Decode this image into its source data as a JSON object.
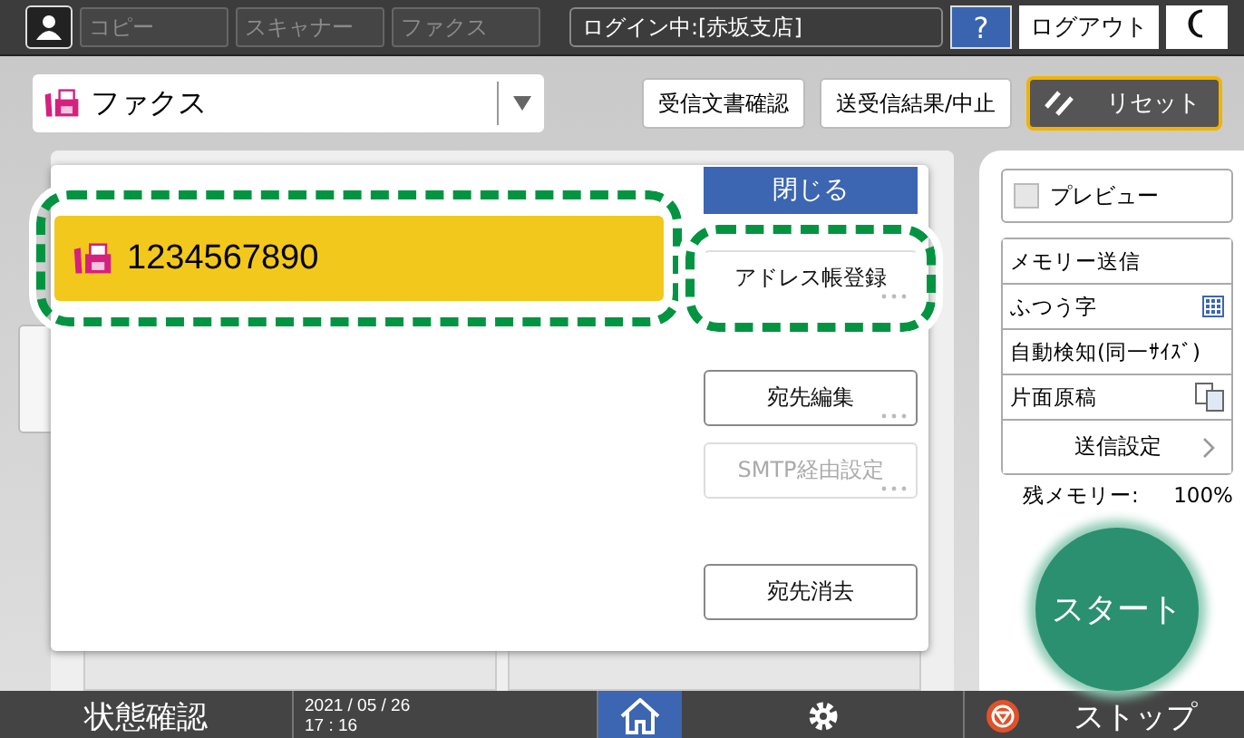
{
  "top_bar": {
    "tabs": [
      {
        "label": "コピー",
        "disabled": true
      },
      {
        "label": "スキャナー",
        "disabled": true
      },
      {
        "label": "ファクス",
        "disabled": true
      }
    ],
    "login": "ログイン中:[赤坂支店]",
    "help": "?",
    "logout": "ログアウト"
  },
  "app_selector": {
    "label": "ファクス"
  },
  "header_buttons": [
    "受信文書確認",
    "送受信結果/中止"
  ],
  "reset": {
    "label": "リセット"
  },
  "popup": {
    "destination": {
      "number": "1234567890",
      "selected": true,
      "highlighted": true
    },
    "close": "閉じる",
    "actions": [
      {
        "label": "アドレス帳登録",
        "disabled": false,
        "more": true,
        "highlighted": true
      },
      {
        "label": "宛先編集",
        "disabled": false,
        "more": true,
        "highlighted": false
      },
      {
        "label": "SMTP経由設定",
        "disabled": true,
        "more": true,
        "highlighted": false
      },
      {
        "label": "宛先消去",
        "disabled": false,
        "more": false,
        "highlighted": false
      }
    ]
  },
  "settings": {
    "preview": {
      "label": "プレビュー",
      "checked": false
    },
    "items": [
      {
        "label": "メモリー送信",
        "kind": "plain"
      },
      {
        "label": "ふつう字",
        "kind": "resolution"
      },
      {
        "label": "自動検知(同一ｻｲｽﾞ)",
        "kind": "plain"
      },
      {
        "label": "片面原稿",
        "kind": "sides"
      }
    ],
    "send_settings": "送信設定",
    "memory_label": "残メモリー:",
    "memory_value": "100%"
  },
  "start": "スタート",
  "bottom_bar": {
    "status": "状態確認",
    "date": "2021 / 05 / 26",
    "time": "17 : 16",
    "stop": "ストップ"
  }
}
